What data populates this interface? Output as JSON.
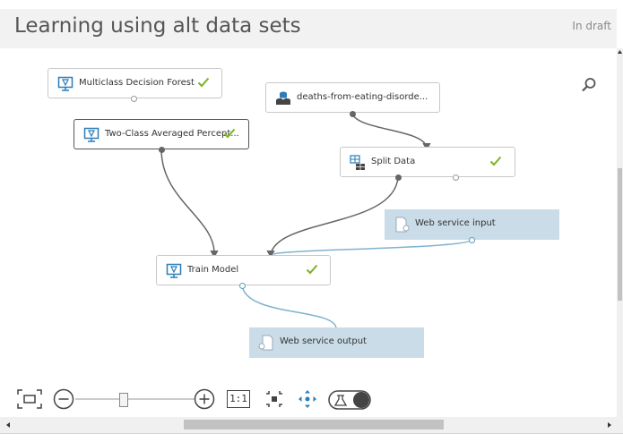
{
  "header": {
    "title": "Learning using alt data sets",
    "status": "In draft"
  },
  "nodes": [
    {
      "id": "multiclass-decision-forest",
      "label": "Multiclass Decision Forest",
      "icon": "model-icon",
      "complete": true
    },
    {
      "id": "two-class-averaged-perceptron",
      "label": "Two-Class Averaged Percept...",
      "icon": "model-icon",
      "complete": true
    },
    {
      "id": "deaths-dataset",
      "label": "deaths-from-eating-disorde...",
      "icon": "dataset-icon",
      "complete": false
    },
    {
      "id": "split-data",
      "label": "Split Data",
      "icon": "split-data-icon",
      "complete": true
    },
    {
      "id": "web-service-input",
      "label": "Web service input",
      "icon": "web-service-icon",
      "complete": false
    },
    {
      "id": "train-model",
      "label": "Train Model",
      "icon": "model-icon",
      "complete": true
    },
    {
      "id": "web-service-output",
      "label": "Web service output",
      "icon": "web-service-icon",
      "complete": false
    }
  ],
  "toolbar": {
    "zoom_actual_label": "1:1",
    "zoom_level": 0.4
  },
  "colors": {
    "check": "#7bb320",
    "web_service_fill": "#c9dce7",
    "web_service_wire": "#7fb3cf",
    "data_wire": "#666666"
  }
}
